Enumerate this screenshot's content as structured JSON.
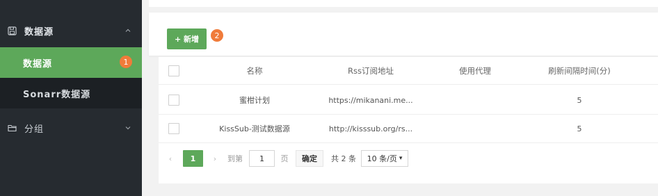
{
  "sidebar": {
    "group_datasource": {
      "label": "数据源",
      "icon": "save-icon",
      "arrow": "chevron-up-icon"
    },
    "items": [
      {
        "label": "数据源",
        "badge": "1",
        "active": true
      },
      {
        "label": "Sonarr数据源",
        "active": false
      }
    ],
    "group_group": {
      "label": "分组",
      "icon": "folder-icon",
      "arrow": "chevron-down-icon"
    }
  },
  "toolbar": {
    "add_label": "+ 新增",
    "badge": "2"
  },
  "table": {
    "headers": [
      "名称",
      "Rss订阅地址",
      "使用代理",
      "刷新间隔时间(分)"
    ],
    "rows": [
      {
        "name": "蜜柑计划",
        "rss": "https://mikanani.me...",
        "proxy": "",
        "interval": "5"
      },
      {
        "name": "KissSub-测试数据源",
        "rss": "http://kisssub.org/rs...",
        "proxy": "",
        "interval": "5"
      }
    ]
  },
  "pager": {
    "prev": "‹",
    "current": "1",
    "next": "›",
    "goto_label": "到第",
    "input_value": "1",
    "page_label": "页",
    "confirm_label": "确定",
    "total_label": "共 2 条",
    "page_size": "10 条/页"
  },
  "colors": {
    "sidebar_bg": "#262b30",
    "accent_green": "#5da85a",
    "badge_orange": "#f07b3a"
  }
}
